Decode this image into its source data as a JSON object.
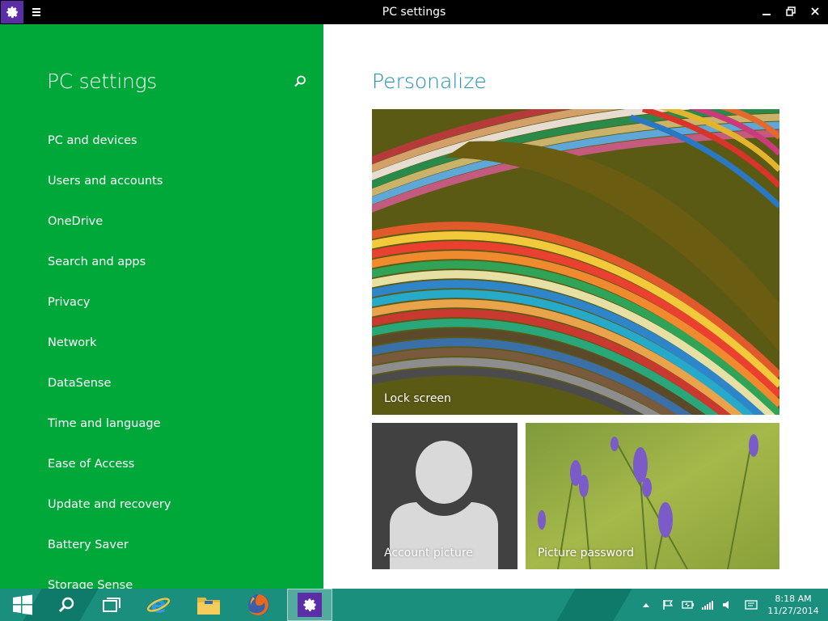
{
  "window": {
    "title": "PC settings"
  },
  "icons": {
    "app": "gear-icon",
    "menu": "hamburger-icon",
    "minimize": "minimize-icon",
    "restore": "restore-icon",
    "close": "close-icon",
    "search": "search-icon"
  },
  "colors": {
    "sidebar": "#00a83a",
    "accent_title": "#1c8fb8",
    "taskbar": "#1a8f7d",
    "app_icon_bg": "#5b2ea8"
  },
  "sidebar": {
    "title": "PC settings",
    "items": [
      {
        "label": "PC and devices"
      },
      {
        "label": "Users and accounts"
      },
      {
        "label": "OneDrive"
      },
      {
        "label": "Search and apps"
      },
      {
        "label": "Privacy"
      },
      {
        "label": "Network"
      },
      {
        "label": "DataSense"
      },
      {
        "label": "Time and language"
      },
      {
        "label": "Ease of Access"
      },
      {
        "label": "Update and recovery"
      },
      {
        "label": "Battery Saver"
      },
      {
        "label": "Storage Sense"
      }
    ]
  },
  "main": {
    "title": "Personalize",
    "tiles": [
      {
        "label": "Lock screen"
      },
      {
        "label": "Account picture"
      },
      {
        "label": "Picture password"
      }
    ]
  },
  "taskbar": {
    "apps": [
      "start-icon",
      "search-icon",
      "task-view-icon",
      "internet-explorer-icon",
      "file-explorer-icon",
      "firefox-icon",
      "pc-settings-icon"
    ],
    "tray": [
      "show-hidden-icons",
      "flag-icon",
      "battery-icon",
      "signal-icon",
      "volume-icon",
      "notification-icon"
    ],
    "clock": {
      "time": "8:18 AM",
      "date": "11/27/2014"
    }
  }
}
